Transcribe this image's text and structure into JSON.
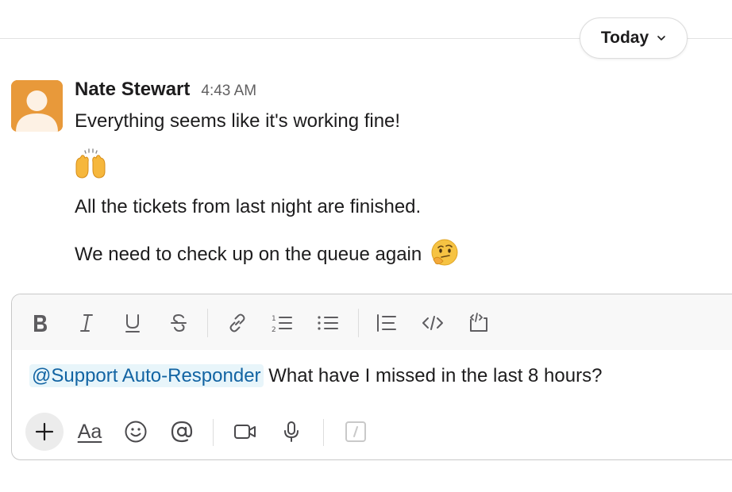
{
  "divider": {
    "date_label": "Today"
  },
  "message": {
    "sender": "Nate Stewart",
    "time": "4:43 AM",
    "lines": [
      "Everything seems like it's working fine!",
      "All the tickets from last night are finished.",
      "We need to check up on the queue again"
    ],
    "emojis": [
      "raising-hands-emoji",
      "thinking-face-emoji"
    ]
  },
  "composer": {
    "mention": "@Support Auto-Responder",
    "text": "What have I missed in the last 8 hours?",
    "formatting_tools": [
      "bold",
      "italic",
      "underline",
      "strikethrough",
      "link",
      "ordered-list",
      "bulleted-list",
      "blockquote",
      "code",
      "code-block"
    ],
    "aa_label": "Aa",
    "bottom_tools": [
      "attach",
      "formatting",
      "emoji",
      "mention",
      "video",
      "audio",
      "shortcuts"
    ]
  },
  "colors": {
    "avatar": "#e8993a",
    "mention_bg": "#e8f5fa",
    "mention_text": "#1264a3"
  }
}
